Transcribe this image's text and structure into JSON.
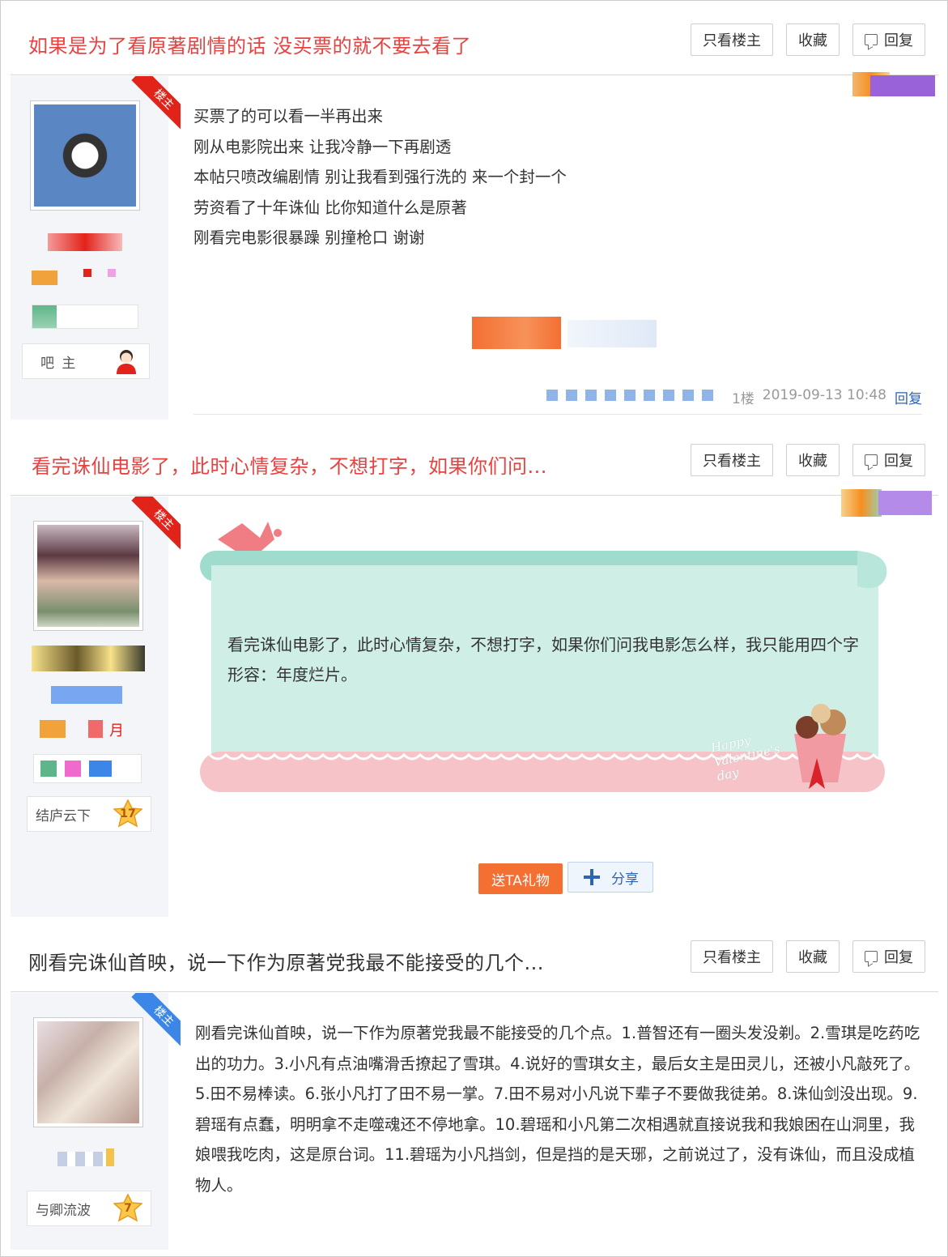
{
  "buttons": {
    "only_op": "只看楼主",
    "favorite": "收藏",
    "reply": "回复"
  },
  "posts": [
    {
      "title": "如果是为了看原著剧情的话 没买票的就不要去看了",
      "ribbon": "楼主",
      "badge": "吧 主",
      "lines": [
        "买票了的可以看一半再出来",
        "刚从电影院出来 让我冷静一下再剧透",
        "本帖只喷改编剧情 别让我看到强行洗的 来一个封一个",
        "劳资看了十年诛仙 比你知道什么是原著",
        "刚看完电影很暴躁 别撞枪口 谢谢"
      ],
      "floor": "1楼",
      "time": "2019-09-13 10:48",
      "reply_link": "回复"
    },
    {
      "title": "看完诛仙电影了，此时心情复杂，不想打字，如果你们问...",
      "ribbon": "楼主",
      "badge": "结庐云下",
      "level": "17",
      "month_fragment": "月",
      "card_text": "看完诛仙电影了，此时心情复杂，不想打字，如果你们问我电影怎么样，我只能用四个字形容：年度烂片。",
      "card_deco": "Happy Valentine's day",
      "gift": "送TA礼物",
      "share": "分享"
    },
    {
      "title": "刚看完诛仙首映，说一下作为原著党我最不能接受的几个...",
      "ribbon": "楼主",
      "badge": "与卿流波",
      "level": "7",
      "body": "刚看完诛仙首映，说一下作为原著党我最不能接受的几个点。1.普智还有一圈头发没剃。2.雪琪是吃药吃出的功力。3.小凡有点油嘴滑舌撩起了雪琪。4.说好的雪琪女主，最后女主是田灵儿，还被小凡敲死了。5.田不易棒读。6.张小凡打了田不易一掌。7.田不易对小凡说下辈子不要做我徒弟。8.诛仙剑没出现。9.碧瑶有点蠢，明明拿不走噬魂还不停地拿。10.碧瑶和小凡第二次相遇就直接说我和我娘困在山洞里，我娘喂我吃肉，这是原台词。11.碧瑶为小凡挡剑，但是挡的是天琊，之前说过了，没有诛仙，而且没成植物人。"
    }
  ]
}
